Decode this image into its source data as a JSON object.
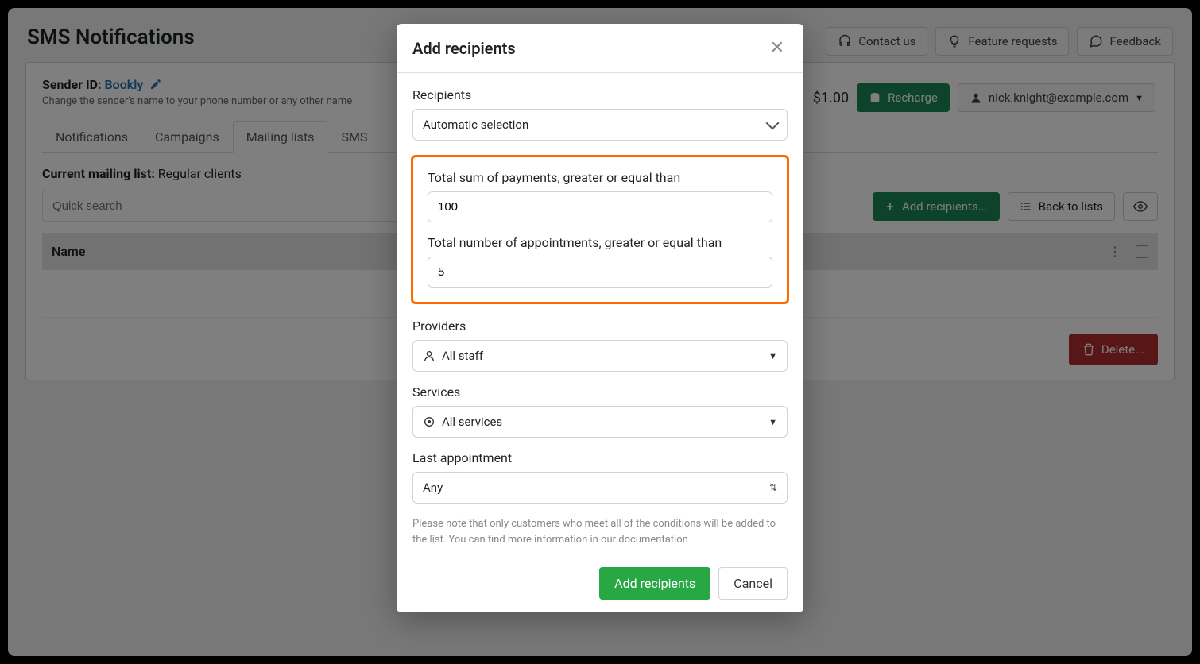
{
  "page": {
    "title": "SMS Notifications"
  },
  "topbar": {
    "contact": "Contact us",
    "feature": "Feature requests",
    "feedback": "Feedback"
  },
  "sender": {
    "label": "Sender ID:",
    "link": "Bookly",
    "hint": "Change the sender's name to your phone number or any other name"
  },
  "tabs": {
    "notifications": "Notifications",
    "campaigns": "Campaigns",
    "mailing": "Mailing lists",
    "sms": "SMS"
  },
  "mailing": {
    "label": "Current mailing list:",
    "name": "Regular clients",
    "search_placeholder": "Quick search",
    "add_btn": "Add recipients...",
    "back_btn": "Back to lists"
  },
  "balance": {
    "amount": "$1.00",
    "recharge": "Recharge",
    "user": "nick.knight@example.com"
  },
  "table": {
    "name_col": "Name"
  },
  "actions": {
    "delete": "Delete..."
  },
  "modal": {
    "title": "Add recipients",
    "recipients_label": "Recipients",
    "recipients_value": "Automatic selection",
    "total_sum_label": "Total sum of payments, greater or equal than",
    "total_sum_value": "100",
    "total_appts_label": "Total number of appointments, greater or equal than",
    "total_appts_value": "5",
    "providers_label": "Providers",
    "providers_value": "All staff",
    "services_label": "Services",
    "services_value": "All services",
    "last_appt_label": "Last appointment",
    "last_appt_value": "Any",
    "note": "Please note that only customers who meet all of the conditions will be added to the list. You can find more information in our documentation",
    "submit": "Add recipients",
    "cancel": "Cancel"
  }
}
